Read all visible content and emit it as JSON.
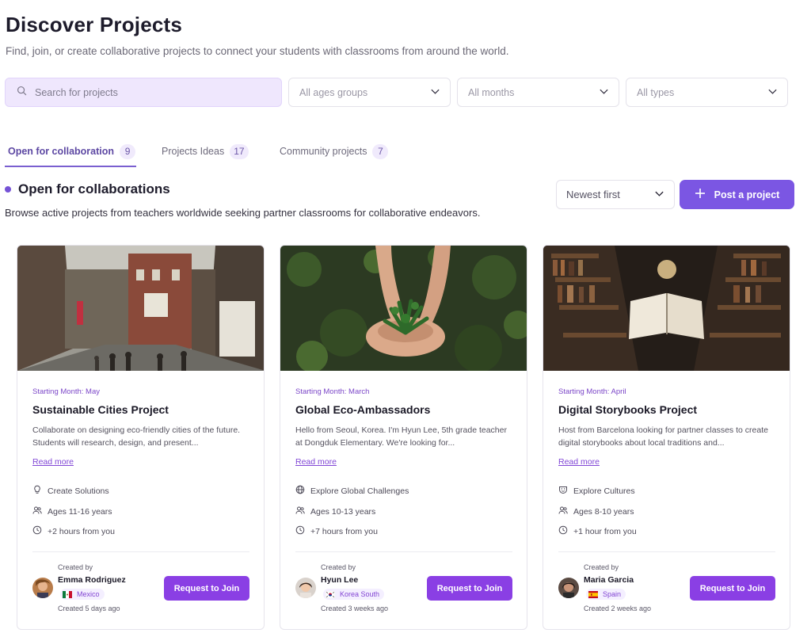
{
  "header": {
    "title": "Discover Projects",
    "subtitle": "Find, join, or create collaborative projects to connect your students with classrooms from around the world."
  },
  "filters": {
    "search_placeholder": "Search for projects",
    "age_groups": "All ages groups",
    "months": "All months",
    "types": "All types"
  },
  "tabs": [
    {
      "label": "Open for collaboration",
      "count": "9",
      "active": true
    },
    {
      "label": "Projects Ideas",
      "count": "17",
      "active": false
    },
    {
      "label": "Community projects",
      "count": "7",
      "active": false
    }
  ],
  "section": {
    "title": "Open for collaborations",
    "description": "Browse active projects from teachers worldwide seeking partner classrooms for collaborative endeavors."
  },
  "sort": {
    "selected": "Newest first"
  },
  "post_button": "Post a project",
  "cards": [
    {
      "month": "Starting Month: May",
      "title": "Sustainable Cities Project",
      "description": "Collaborate on designing eco-friendly cities of the future. Students will research, design, and present...",
      "read_more": "Read more",
      "theme": "Create Solutions",
      "theme_icon": "lightbulb-icon",
      "ages": "Ages 11-16 years",
      "time": "+2 hours from you",
      "created_by": "Created by",
      "creator": "Emma Rodriguez",
      "country": "Mexico",
      "created_ago": "Created 5 days ago",
      "join": "Request to Join"
    },
    {
      "month": "Starting Month: March",
      "title": "Global Eco-Ambassadors",
      "description": "Hello from Seoul, Korea. I'm Hyun Lee, 5th grade teacher at Dongduk Elementary. We're looking for...",
      "read_more": "Read more",
      "theme": "Explore Global Challenges",
      "theme_icon": "globe-icon",
      "ages": "Ages 10-13 years",
      "time": "+7 hours from you",
      "created_by": "Created by",
      "creator": "Hyun Lee",
      "country": "Korea South",
      "created_ago": "Created 3 weeks ago",
      "join": "Request to Join"
    },
    {
      "month": "Starting Month: April",
      "title": "Digital Storybooks Project",
      "description": "Host from Barcelona looking for partner classes to create digital storybooks about local traditions and...",
      "read_more": "Read more",
      "theme": "Explore Cultures",
      "theme_icon": "culture-mask-icon",
      "ages": "Ages 8-10 years",
      "time": "+1 hour from you",
      "created_by": "Created by",
      "creator": "Maria Garcia",
      "country": "Spain",
      "created_ago": "Created 2 weeks ago",
      "join": "Request to Join"
    }
  ]
}
